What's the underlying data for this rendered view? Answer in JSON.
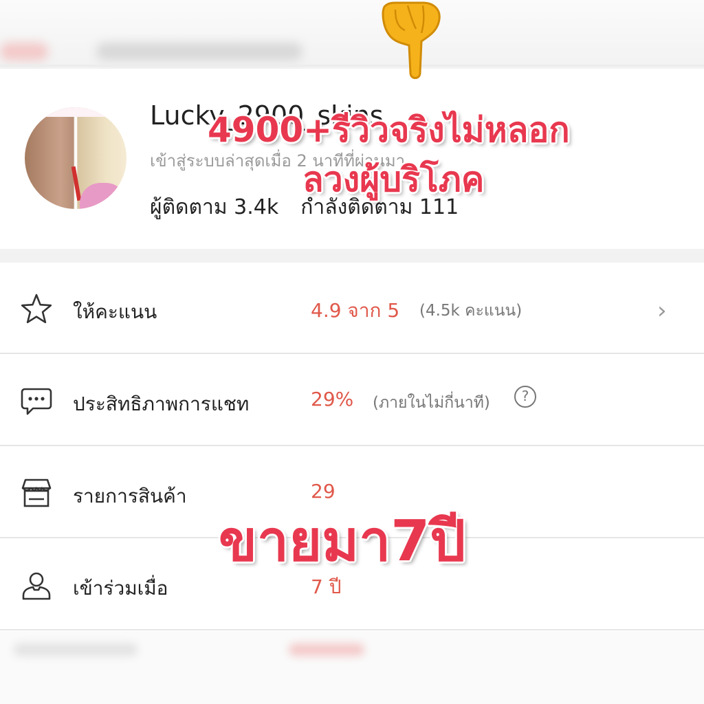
{
  "profile": {
    "shop_name": "Lucky_2900_skins",
    "last_login": "เข้าสู่ระบบล่าสุดเมื่อ 2 นาทีที่ผ่านมา",
    "followers": "ผู้ติดตาม 3.4k",
    "following": "กำลังติดตาม 111"
  },
  "rows": [
    {
      "label": "ให้คะแนน",
      "value": "4.9 จาก 5",
      "sub": "(4.5k คะแนน)",
      "icon": "star-icon"
    },
    {
      "label": "ประสิทธิภาพการแชท",
      "value": "29%",
      "sub": "(ภายในไม่กี่นาที)",
      "icon": "chat-icon"
    },
    {
      "label": "รายการสินค้า",
      "value": "29",
      "icon": "store-icon"
    },
    {
      "label": "เข้าร่วมเมื่อ",
      "value": "7 ปี",
      "icon": "user-icon"
    }
  ],
  "overlay": {
    "line1": "4900+รีวิวจริงไม่หลอก",
    "line2": "ลวงผู้บริโภค",
    "line3": "ขายมา7ปี"
  },
  "icons": {
    "hand": "pointing-down-hand-icon",
    "chevron": "chevron-right-icon",
    "help": "question-icon"
  },
  "colors": {
    "accent": "#e0584a",
    "overlay": "#e8384f",
    "text": "#222222",
    "muted": "#777777"
  }
}
